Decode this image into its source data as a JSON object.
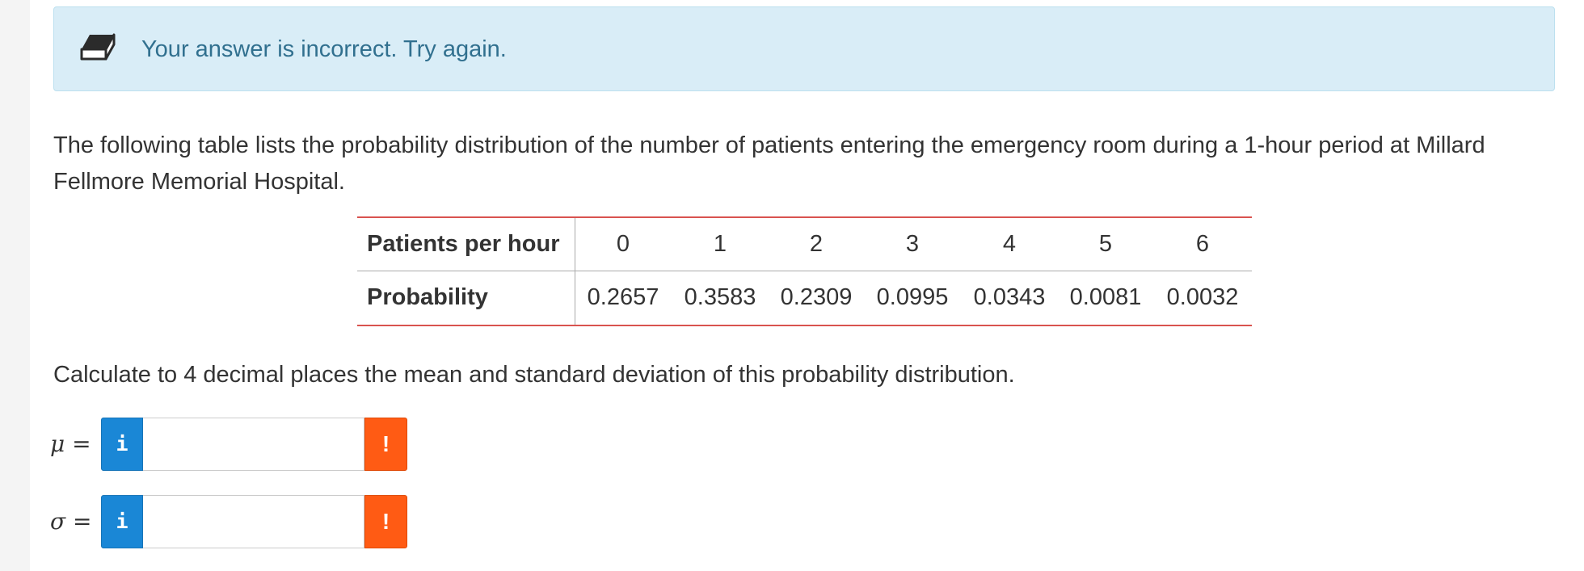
{
  "alert": {
    "icon": "eraser-icon",
    "message": "Your answer is incorrect.  Try again.",
    "bg_color": "#d9edf7",
    "text_color": "#31708f"
  },
  "intro_text": "The following table lists the probability distribution of the number of patients entering the emergency room during a 1-hour period at Millard Fellmore Memorial Hospital.",
  "table": {
    "row1_label": "Patients per hour",
    "row2_label": "Probability",
    "patients": [
      "0",
      "1",
      "2",
      "3",
      "4",
      "5",
      "6"
    ],
    "probabilities": [
      "0.2657",
      "0.3583",
      "0.2309",
      "0.0995",
      "0.0343",
      "0.0081",
      "0.0032"
    ],
    "rule_color": "#d9534f"
  },
  "question_text": "Calculate to 4 decimal places the mean and standard deviation of this probability distribution.",
  "answers": [
    {
      "symbol": "μ",
      "equals": "=",
      "value": "",
      "info_label": "i",
      "warn_label": "!"
    },
    {
      "symbol": "σ",
      "equals": "=",
      "value": "",
      "info_label": "i",
      "warn_label": "!"
    }
  ],
  "colors": {
    "info_button": "#1a87d6",
    "warning_button": "#ff5b14"
  }
}
